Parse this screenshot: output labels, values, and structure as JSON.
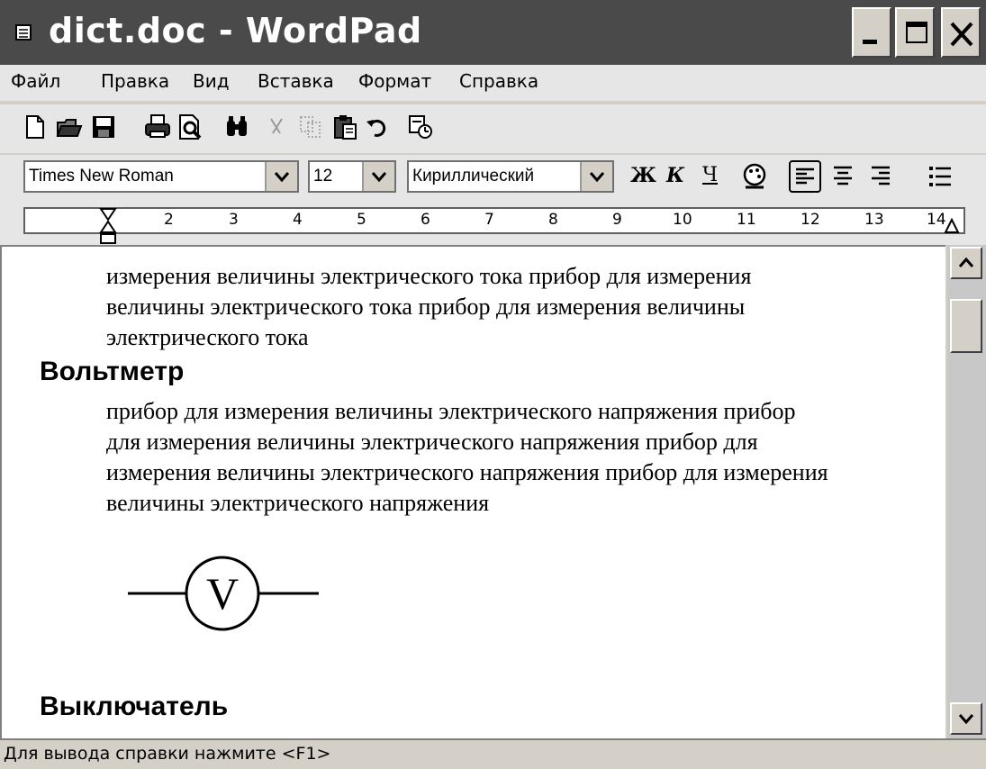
{
  "window": {
    "title": "dict.doc - WordPad",
    "icon": "document-icon",
    "controls": [
      "minimize-icon",
      "maximize-icon",
      "close-icon"
    ]
  },
  "menu": {
    "items": [
      "Файл",
      "Правка",
      "Вид",
      "Вставка",
      "Формат",
      "Справка"
    ]
  },
  "toolbar": {
    "buttons": [
      "new-icon",
      "open-icon",
      "save-icon",
      "print-icon",
      "print-preview-icon",
      "find-icon",
      "cut-icon",
      "copy-icon",
      "paste-icon",
      "undo-icon",
      "insert-datetime-icon"
    ]
  },
  "format_bar": {
    "font": "Times New Roman",
    "size": "12",
    "script": "Кириллический",
    "bold": "Ж",
    "italic": "К",
    "underline": "Ч"
  },
  "ruler": {
    "numbers": [
      "2",
      "3",
      "4",
      "5",
      "6",
      "7",
      "8",
      "9",
      "10",
      "11",
      "12",
      "13",
      "14"
    ]
  },
  "document": {
    "para1_lines": [
      "измерения величины электрического тока прибор для измерения",
      "величины электрического тока прибор для измерения величины",
      "электрического тока"
    ],
    "heading1": "Вольтметр",
    "para2_lines": [
      "прибор для измерения величины электрического напряжения прибор",
      "для измерения величины электрического напряжения прибор для",
      "измерения величины электрического напряжения прибор для измерения",
      "величины электрического напряжения"
    ],
    "symbol_letter": "V",
    "heading2": "Выключатель"
  },
  "status": {
    "text": "Для вывода справки нажмите <F1>"
  }
}
